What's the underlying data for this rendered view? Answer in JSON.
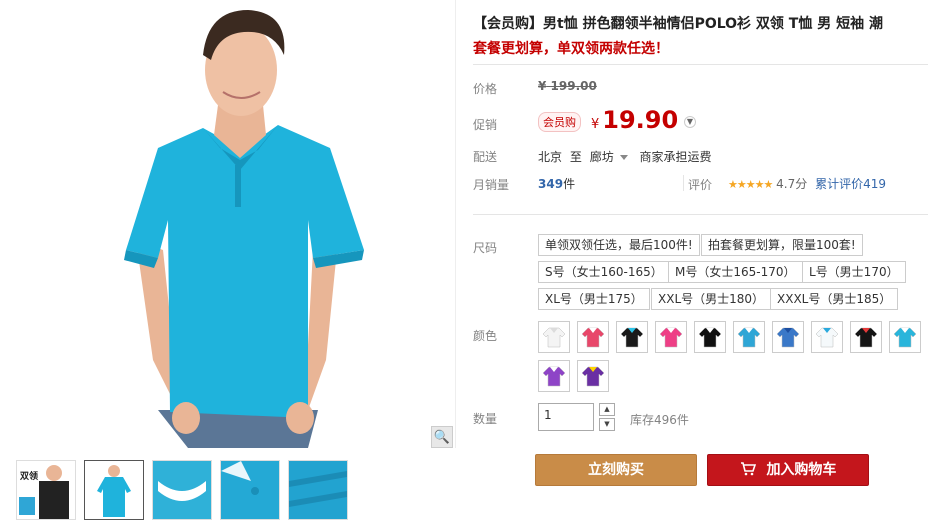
{
  "product": {
    "title": "【会员购】男t恤 拼色翻领半袖情侣POLO衫 双领 T恤 男 短袖 潮",
    "subtitle": "套餐更划算，单双领两款任选！"
  },
  "pricing": {
    "original_label": "价格",
    "original_currency": "¥",
    "original_price": "199.00",
    "promo_label": "促销",
    "promo_badge": "会员购",
    "promo_currency": "¥",
    "promo_price": "19.90"
  },
  "shipping": {
    "label": "配送",
    "from": "北京",
    "to_word": "至",
    "to": "廊坊",
    "fee_text": "商家承担运费"
  },
  "sales": {
    "label": "月销量",
    "count": "349",
    "unit": "件",
    "rating_label": "评价",
    "stars": "★★★★★",
    "score": "4.7分",
    "total_reviews": "累计评价419"
  },
  "size": {
    "label": "尺码",
    "options": [
      "单领双领任选，最后100件!",
      "拍套餐更划算，限量100套!",
      "S号（女士160-165）",
      "M号（女士165-170）",
      "L号（男士170）",
      "XL号（男士175）",
      "XXL号（男士180）",
      "XXXL号（男士185）"
    ]
  },
  "color": {
    "label": "颜色",
    "swatches": [
      "#f4f4f4",
      "#e8476a",
      "#1a1a1a",
      "#ee3f86",
      "#111111",
      "#2fa6d6",
      "#3a78c8",
      "#f5f9fb",
      "#151515",
      "#29b5db",
      "#8e44c7",
      "#6a2fa3"
    ],
    "collar_colors": [
      "#dcdcdc",
      "#ffffff",
      "#2ec4e8",
      "#ffffff",
      "#ffffff",
      "#ffffff",
      "#1d4fa0",
      "#29a9dd",
      "#e53a3a",
      "#ffffff",
      "#ffffff",
      "#ffd400"
    ]
  },
  "quantity": {
    "label": "数量",
    "value": "1",
    "stock": "库存496件"
  },
  "actions": {
    "buy_now": "立刻购买",
    "add_to_cart": "加入购物车"
  },
  "gallery": {
    "thumb1_text": "双领"
  }
}
